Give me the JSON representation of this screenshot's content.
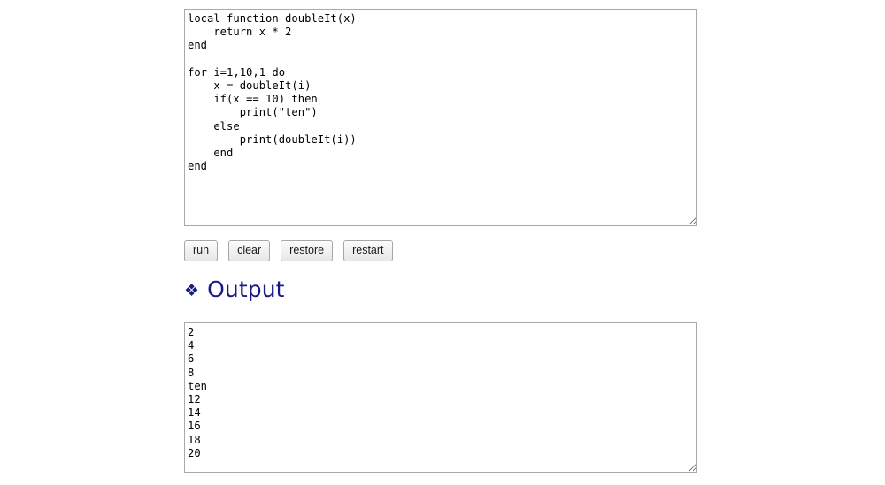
{
  "editor": {
    "name": "lua-code-editor",
    "code": "local function doubleIt(x)\n    return x * 2\nend\n\nfor i=1,10,1 do\n    x = doubleIt(i)\n    if(x == 10) then\n        print(\"ten\")\n    else\n        print(doubleIt(i))\n    end\nend",
    "placeholder": ""
  },
  "toolbar": {
    "buttons": [
      {
        "id": "run",
        "label": "run"
      },
      {
        "id": "clear",
        "label": "clear"
      },
      {
        "id": "restore",
        "label": "restore"
      },
      {
        "id": "restart",
        "label": "restart"
      }
    ]
  },
  "output_section": {
    "bullet_icon": "❖",
    "bullet_icon_name": "diamond-bullet-icon",
    "title": "Output",
    "title_color": "#1a1a82",
    "content": "2\n4\n6\n8\nten\n12\n14\n16\n18\n20",
    "placeholder": "",
    "lines": [
      "2",
      "4",
      "6",
      "8",
      "ten",
      "12",
      "14",
      "16",
      "18",
      "20"
    ]
  },
  "colors": {
    "page_background": "#ffffff",
    "text": "#000000",
    "field_border": "#a9a9a9",
    "button_border": "#a6a6a6",
    "heading": "#1a1a82"
  }
}
